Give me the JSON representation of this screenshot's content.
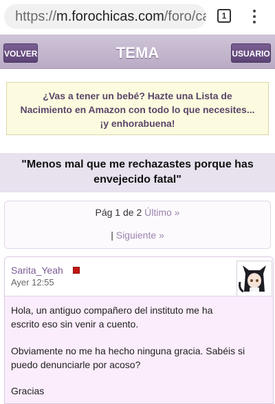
{
  "browser": {
    "url_scheme": "https://",
    "url_host": "m.forochicas.com",
    "url_path": "/foro/ca",
    "tab_count": "1"
  },
  "header": {
    "back_label": "VOLVER",
    "title": "TEMA",
    "user_label": "USUARIO"
  },
  "ad": {
    "lines": [
      "¿Vas a tener un bebé? Hazte una Lista de",
      "Nacimiento en Amazon con todo lo que necesites...",
      "¡y enhorabuena!"
    ]
  },
  "thread": {
    "title_lines": [
      "\"Menos mal que me rechazastes porque has",
      "envejecido fatal\""
    ]
  },
  "pagination": {
    "page_text": "Pág 1 de 2",
    "last_link": "Último »",
    "separator": "|",
    "next_link": "Siguiente »"
  },
  "post": {
    "username": "Sarita_Yeah",
    "time": "Ayer 12:55",
    "lines": [
      "Hola, un antiguo compañero del instituto me ha",
      "escrito eso sin venir a cuento.",
      "Obviamente no me ha hecho ninguna gracia. Sabéis si",
      "puedo denunciarle por acoso?",
      "Gracias"
    ]
  },
  "colors": {
    "header_bg": "#c4b6cf",
    "button_bg": "#6a4f84",
    "link": "#9a83ad",
    "post_bg": "#fbedfc",
    "status_red": "#c31515"
  }
}
